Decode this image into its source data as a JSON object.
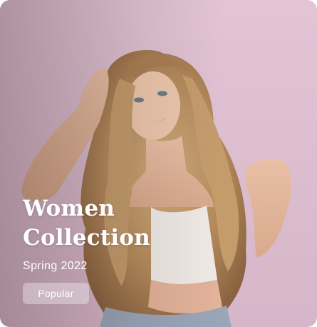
{
  "card": {
    "title_line1": "Women",
    "title_line2": "Collection",
    "subtitle": "Spring 2022",
    "badge_label": "Popular"
  }
}
